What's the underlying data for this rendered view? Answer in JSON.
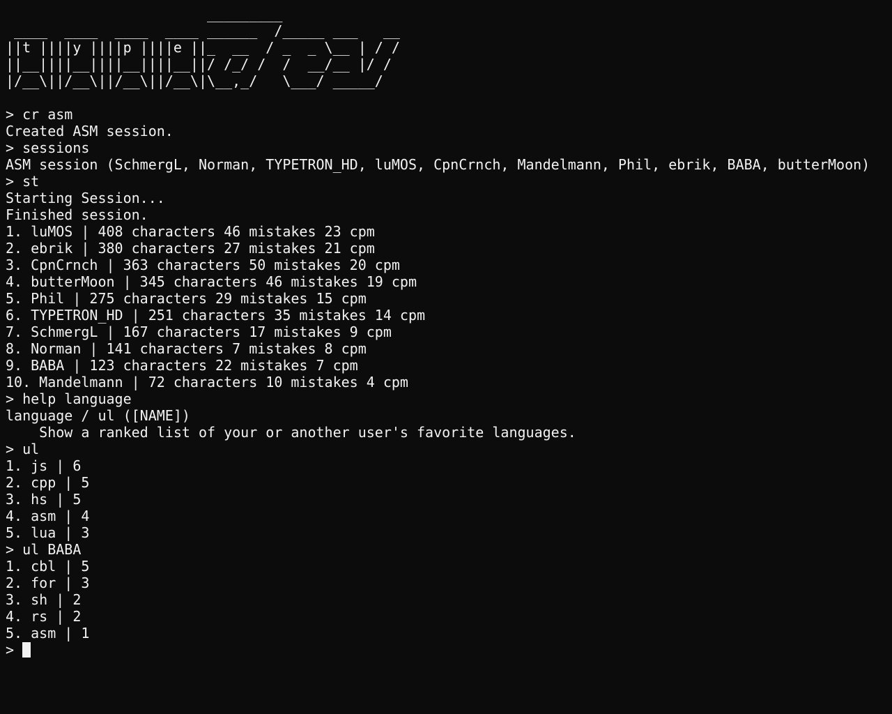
{
  "terminal": {
    "banner": [
      "                        _________",
      " ____  ____  ____  ____ ______  /_____ ___   __",
      "||t ||||y ||||p ||||e ||_  __  / _  _ \\__ | / /",
      "||__||||__||||__||||__||/ /_/ /  /  __/__ |/ /",
      "|/__\\||/__\\||/__\\||/__\\|\\__,_/   \\___/ _____/"
    ],
    "lines": [
      "",
      "> cr asm",
      "Created ASM session.",
      "> sessions",
      "ASM session (SchmergL, Norman, TYPETRON_HD, luMOS, CpnCrnch, Mandelmann, Phil, ebrik, BABA, butterMoon)",
      "> st",
      "Starting Session...",
      "Finished session.",
      "1. luMOS | 408 characters 46 mistakes 23 cpm",
      "2. ebrik | 380 characters 27 mistakes 21 cpm",
      "3. CpnCrnch | 363 characters 50 mistakes 20 cpm",
      "4. butterMoon | 345 characters 46 mistakes 19 cpm",
      "5. Phil | 275 characters 29 mistakes 15 cpm",
      "6. TYPETRON_HD | 251 characters 35 mistakes 14 cpm",
      "7. SchmergL | 167 characters 17 mistakes 9 cpm",
      "8. Norman | 141 characters 7 mistakes 8 cpm",
      "9. BABA | 123 characters 22 mistakes 7 cpm",
      "10. Mandelmann | 72 characters 10 mistakes 4 cpm",
      "> help language",
      "language / ul ([NAME])",
      "    Show a ranked list of your or another user's favorite languages.",
      "> ul",
      "1. js | 6",
      "2. cpp | 5",
      "3. hs | 5",
      "4. asm | 4",
      "5. lua | 3",
      "> ul BABA",
      "1. cbl | 5",
      "2. for | 3",
      "3. sh | 2",
      "4. rs | 2",
      "5. asm | 1"
    ],
    "prompt": "> ",
    "colors": {
      "background": "#0c0c0c",
      "foreground": "#f2f2f2",
      "cursor": "#f2f2f2"
    }
  }
}
